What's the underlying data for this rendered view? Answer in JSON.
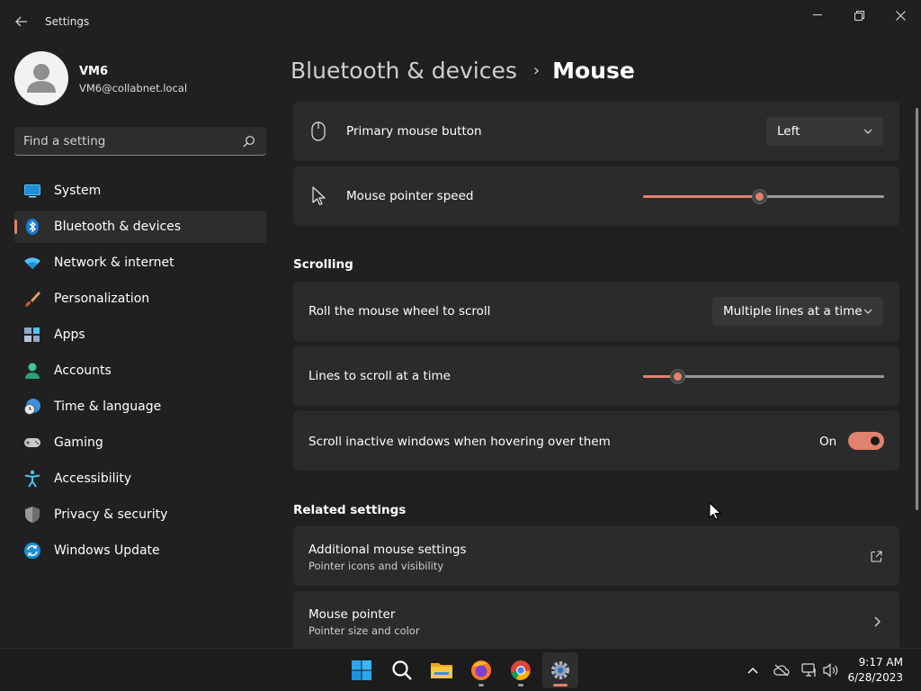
{
  "app": {
    "title": "Settings"
  },
  "user": {
    "name": "VM6",
    "email": "VM6@collabnet.local"
  },
  "search": {
    "placeholder": "Find a setting"
  },
  "sidebar": {
    "items": [
      {
        "label": "System",
        "icon": "monitor-icon"
      },
      {
        "label": "Bluetooth & devices",
        "icon": "bluetooth-icon",
        "active": true
      },
      {
        "label": "Network & internet",
        "icon": "wifi-icon"
      },
      {
        "label": "Personalization",
        "icon": "brush-icon"
      },
      {
        "label": "Apps",
        "icon": "apps-icon"
      },
      {
        "label": "Accounts",
        "icon": "person-icon"
      },
      {
        "label": "Time & language",
        "icon": "globe-clock-icon"
      },
      {
        "label": "Gaming",
        "icon": "gamepad-icon"
      },
      {
        "label": "Accessibility",
        "icon": "accessibility-icon"
      },
      {
        "label": "Privacy & security",
        "icon": "shield-icon"
      },
      {
        "label": "Windows Update",
        "icon": "update-icon"
      }
    ]
  },
  "breadcrumb": {
    "parent": "Bluetooth & devices",
    "separator": "›",
    "current": "Mouse"
  },
  "settings": {
    "primary_button": {
      "label": "Primary mouse button",
      "value": "Left"
    },
    "pointer_speed": {
      "label": "Mouse pointer speed",
      "value_fraction": 0.48
    },
    "scrolling_section": "Scrolling",
    "roll_wheel": {
      "label": "Roll the mouse wheel to scroll",
      "value": "Multiple lines at a time"
    },
    "lines_to_scroll": {
      "label": "Lines to scroll at a time",
      "value_fraction": 0.14
    },
    "scroll_inactive": {
      "label": "Scroll inactive windows when hovering over them",
      "state": "On"
    },
    "related_section": "Related settings",
    "additional_mouse": {
      "label": "Additional mouse settings",
      "sublabel": "Pointer icons and visibility"
    },
    "mouse_pointer": {
      "label": "Mouse pointer",
      "sublabel": "Pointer size and color"
    }
  },
  "colors": {
    "accent": "#e0826e",
    "background": "#202020",
    "card": "#2b2b2b"
  },
  "taskbar": {
    "apps": [
      "start-icon",
      "search-icon",
      "file-explorer-icon",
      "firefox-icon",
      "chrome-icon",
      "settings-icon"
    ],
    "time": "9:17 AM",
    "date": "6/28/2023"
  }
}
